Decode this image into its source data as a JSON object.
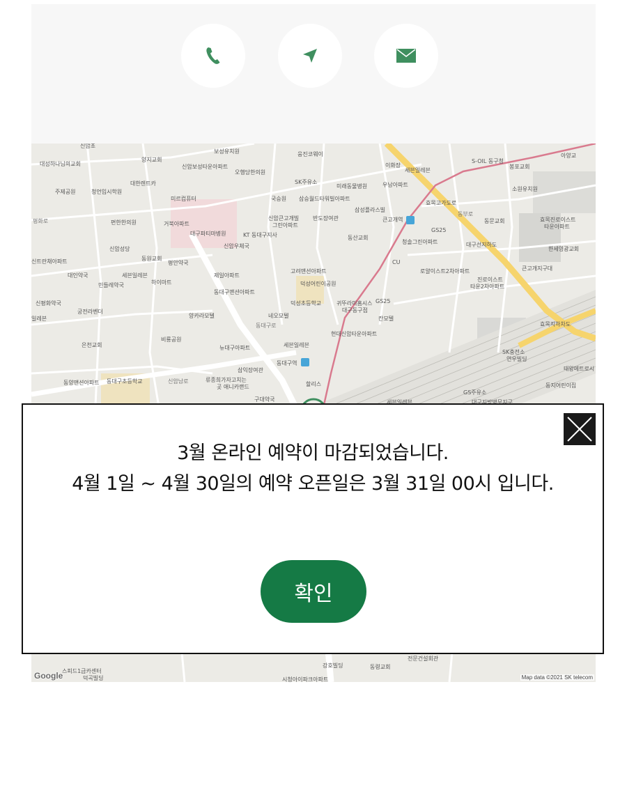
{
  "contact": {
    "phone_icon": "phone-icon",
    "directions_icon": "navigation-arrow-icon",
    "mail_icon": "envelope-icon",
    "icon_color": "#3f8f5f"
  },
  "map": {
    "google_logo": "Google",
    "attribution": "Map data ©2021 SK telecom",
    "labels": [
      "신암초",
      "보성유치원",
      "웅진코웨이",
      "이화장",
      "세븐일레븐",
      "S-OIL 동구청",
      "봉포교회",
      "아양교",
      "대성하나님의교회",
      "양지교회",
      "신암보성타운아파트",
      "오행당한의원",
      "SK주유소",
      "미래동물병원",
      "우남아파트",
      "주제공원",
      "청언입시학원",
      "대한렌트카",
      "미르컴퓨터",
      "국승원",
      "삼승월드타워빌아파트",
      "효목고가도로",
      "소원유치원",
      "평화로",
      "편한한의원",
      "거북아파트",
      "신암큰고개빌",
      "그린아파트",
      "반도장여관",
      "삼성플라스빌",
      "큰고개역",
      "GS25",
      "동문교회",
      "효목진로이스트",
      "타운아파트",
      "대구파티마병원",
      "KT 동대구지사",
      "동산교회",
      "청솔그린아파트",
      "대구선지하도",
      "신암성당",
      "신암우체국",
      "한세영광교회",
      "신트란채아파트",
      "동원교회",
      "평안약국",
      "CU",
      "고려맨션아파트",
      "로얄이스트2차아파트",
      "큰고개지구대",
      "대인약국",
      "세븐일레븐",
      "하이마트",
      "제일아파트",
      "덕성어린이공원",
      "진로이스트",
      "타운2차아파트",
      "민들레약국",
      "동대구맨션아파트",
      "덕성초등학교",
      "귀뚜라미홈시스",
      "대구동구점",
      "GS25",
      "신평화약국",
      "궁전라벤더",
      "양카라모텔",
      "네오모텔",
      "칸모텔",
      "효목지하차도",
      "일레븐",
      "비룡공원",
      "현대신암타운아파트",
      "은천교회",
      "뉴대구아파트",
      "세븐일레븐",
      "SK충전소",
      "연우빌딩",
      "태왕메트로시",
      "삼익장여관",
      "동대구역",
      "동양맨션아파트",
      "동대구초등학교",
      "신암남로",
      "류종희가자고치는",
      "곳 애니카랜드",
      "할리스",
      "동지어린이집",
      "구대약국",
      "세븐일레븐",
      "GS주유소",
      "대구지방병무지구",
      "스피드1급카센터",
      "덕곡빌딩",
      "강호빌딩",
      "동령교회",
      "전문건설회관",
      "시청아이파크아파트",
      "동대구로",
      "동부로"
    ]
  },
  "modal": {
    "line1": "3월 온라인 예약이 마감되었습니다.",
    "line2": "4월 1일 ~ 4월 30일의 예약 오픈일은 3월 31일 00시 입니다.",
    "confirm_label": "확인",
    "close_icon": "close-icon",
    "confirm_color": "#157a45"
  }
}
